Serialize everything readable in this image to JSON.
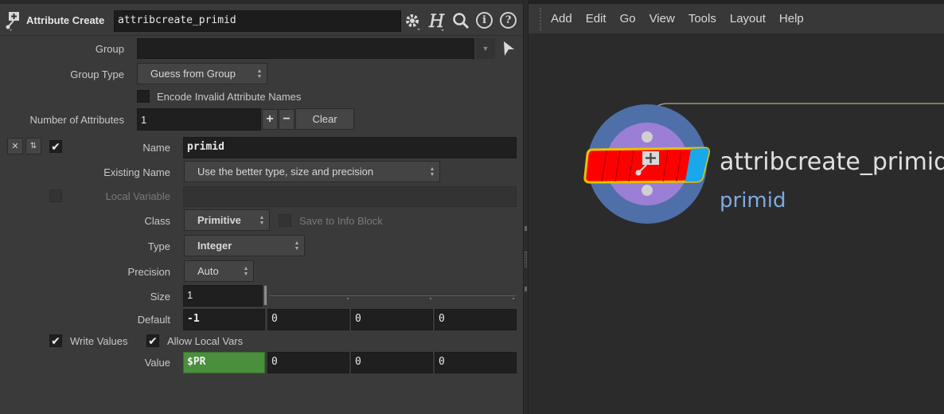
{
  "header": {
    "node_type": "Attribute Create",
    "node_name": "attribcreate_primid"
  },
  "params": {
    "group": {
      "label": "Group",
      "value": ""
    },
    "group_type": {
      "label": "Group Type",
      "value": "Guess from Group"
    },
    "encode_invalid": {
      "label": "Encode Invalid Attribute Names",
      "checked": false
    },
    "num_attributes": {
      "label": "Number of Attributes",
      "value": "1",
      "plus": "+",
      "minus": "−",
      "clear": "Clear"
    },
    "name": {
      "label": "Name",
      "value": "primid",
      "enabled": true
    },
    "existing_name": {
      "label": "Existing Name",
      "value": "Use the better type, size and precision"
    },
    "local_variable": {
      "label": "Local Variable",
      "value": "",
      "checked": false
    },
    "class": {
      "label": "Class",
      "value": "Primitive"
    },
    "save_info": {
      "label": "Save to Info Block",
      "checked": false
    },
    "type": {
      "label": "Type",
      "value": "Integer"
    },
    "precision": {
      "label": "Precision",
      "value": "Auto"
    },
    "size": {
      "label": "Size",
      "value": "1"
    },
    "default": {
      "label": "Default",
      "values": [
        "-1",
        "0",
        "0",
        "0"
      ]
    },
    "write_values": {
      "label": "Write Values",
      "checked": true
    },
    "allow_local_vars": {
      "label": "Allow Local Vars",
      "checked": true
    },
    "value": {
      "label": "Value",
      "values": [
        "$PR",
        "0",
        "0",
        "0"
      ]
    }
  },
  "menubar": {
    "items": [
      "Add",
      "Edit",
      "Go",
      "View",
      "Tools",
      "Layout",
      "Help"
    ]
  },
  "network": {
    "node_label": "attribcreate_primid",
    "node_comment": "primid"
  },
  "colors": {
    "node_red": "#ff0000",
    "node_flag_blue": "#1aa7ec",
    "node_outline": "#e6c400",
    "ring_outer": "#4f6fa8",
    "ring_inner": "#9b7fd6",
    "expr_green": "#4a8f3c",
    "comment_blue": "#7fa9e0"
  }
}
